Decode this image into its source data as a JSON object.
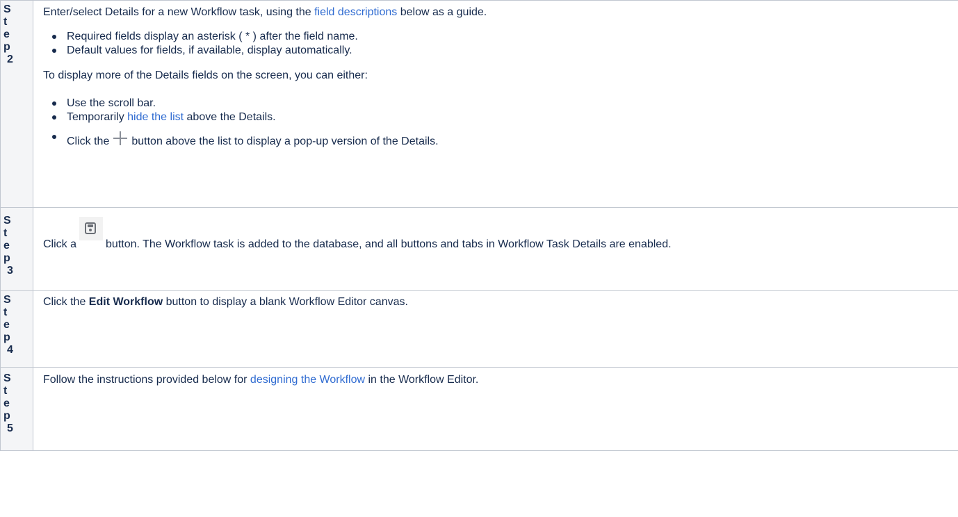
{
  "steps": [
    {
      "label_chars": [
        "S",
        "t",
        "e",
        "p",
        "2"
      ],
      "intro_before": "Enter/select Details for a new Workflow task, using the ",
      "intro_link": "field descriptions",
      "intro_after": " below as a guide.",
      "bullets1": [
        "Required fields display an asterisk ( * ) after the field name.",
        "Default values for fields, if available, display automatically."
      ],
      "para2": "To display more of the Details fields on the screen, you can either:",
      "bullet_scroll": "Use the scroll bar.",
      "bullet_hide_before": "Temporarily ",
      "bullet_hide_link": "hide the list",
      "bullet_hide_after": " above the Details.",
      "bullet_click_before": "Click the",
      "bullet_click_icon": "plus-icon",
      "bullet_click_after": "button above the list to display a pop-up version of the Details."
    },
    {
      "label_chars": [
        "S",
        "t",
        "e",
        "p",
        "3"
      ],
      "text_before": "Click a",
      "icon": "save-icon",
      "text_after": "button. The Workflow task is added to the database, and all buttons and tabs in Workflow Task Details are enabled."
    },
    {
      "label_chars": [
        "S",
        "t",
        "e",
        "p",
        "4"
      ],
      "text_before": "Click the ",
      "bold": "Edit Workflow",
      "text_after": " button to display a blank Workflow Editor canvas."
    },
    {
      "label_chars": [
        "S",
        "t",
        "e",
        "p",
        "5"
      ],
      "text_before": "Follow the instructions provided below for ",
      "link": "designing the Workflow",
      "text_after": " in the Workflow Editor."
    }
  ],
  "colors": {
    "link": "#2f6bd1",
    "label_bg": "#f4f5f7",
    "border": "#c1c7d0"
  }
}
